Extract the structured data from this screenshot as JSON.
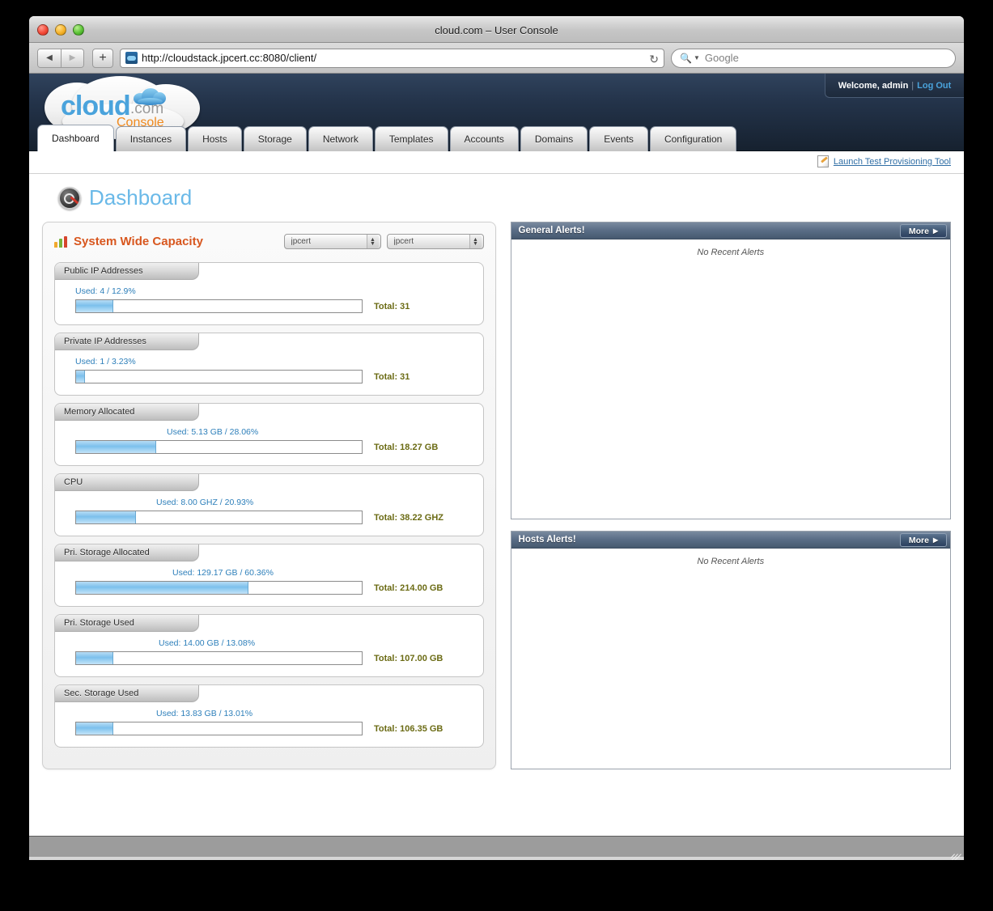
{
  "window": {
    "title": "cloud.com – User Console",
    "traffic_lights": [
      "close",
      "minimize",
      "maximize"
    ]
  },
  "toolbar": {
    "back_label": "◀",
    "forward_label": "▶",
    "add_tab_label": "+",
    "url": "http://cloudstack.jpcert.cc:8080/client/",
    "reload_label": "↻",
    "search_placeholder": "Google",
    "search_value": ""
  },
  "header": {
    "logo_main": "cloud",
    "logo_dotcom": ".com",
    "logo_sub": "Console",
    "welcome_text": "Welcome, admin",
    "separator": "|",
    "logout_label": "Log Out"
  },
  "tabs": [
    {
      "label": "Dashboard",
      "active": true
    },
    {
      "label": "Instances",
      "active": false
    },
    {
      "label": "Hosts",
      "active": false
    },
    {
      "label": "Storage",
      "active": false
    },
    {
      "label": "Network",
      "active": false
    },
    {
      "label": "Templates",
      "active": false
    },
    {
      "label": "Accounts",
      "active": false
    },
    {
      "label": "Domains",
      "active": false
    },
    {
      "label": "Events",
      "active": false
    },
    {
      "label": "Configuration",
      "active": false
    }
  ],
  "subbar": {
    "provisioning_link": "Launch Test Provisioning Tool"
  },
  "page": {
    "title": "Dashboard"
  },
  "capacity": {
    "title": "System Wide Capacity",
    "zone_select": {
      "value": "jpcert"
    },
    "pod_select": {
      "value": "jpcert"
    },
    "items": [
      {
        "label": "Public IP Addresses",
        "used_text": "Used: 4 / 12.9%",
        "total_text": "Total: 31",
        "percent": 12.9
      },
      {
        "label": "Private IP Addresses",
        "used_text": "Used: 1 / 3.23%",
        "total_text": "Total: 31",
        "percent": 3.23
      },
      {
        "label": "Memory Allocated",
        "used_text": "Used: 5.13 GB / 28.06%",
        "total_text": "Total: 18.27 GB",
        "percent": 28.06
      },
      {
        "label": "CPU",
        "used_text": "Used: 8.00 GHZ / 20.93%",
        "total_text": "Total: 38.22 GHZ",
        "percent": 20.93
      },
      {
        "label": "Pri. Storage Allocated",
        "used_text": "Used: 129.17 GB / 60.36%",
        "total_text": "Total: 214.00 GB",
        "percent": 60.36
      },
      {
        "label": "Pri. Storage Used",
        "used_text": "Used: 14.00 GB / 13.08%",
        "total_text": "Total: 107.00 GB",
        "percent": 13.08
      },
      {
        "label": "Sec. Storage Used",
        "used_text": "Used: 13.83 GB / 13.01%",
        "total_text": "Total: 106.35 GB",
        "percent": 13.01
      }
    ]
  },
  "alerts": {
    "general": {
      "title": "General Alerts!",
      "more_label": "More",
      "more_arrow": "▶",
      "empty_text": "No Recent Alerts"
    },
    "hosts": {
      "title": "Hosts Alerts!",
      "more_label": "More",
      "more_arrow": "▶",
      "empty_text": "No Recent Alerts"
    }
  },
  "colors": {
    "accent_blue": "#6ab9e8",
    "capacity_title": "#d8571f",
    "used_text": "#2d7fba",
    "total_text": "#6b6b14",
    "bar_fill": "#7cc0ec",
    "link": "#2f6ea5"
  }
}
